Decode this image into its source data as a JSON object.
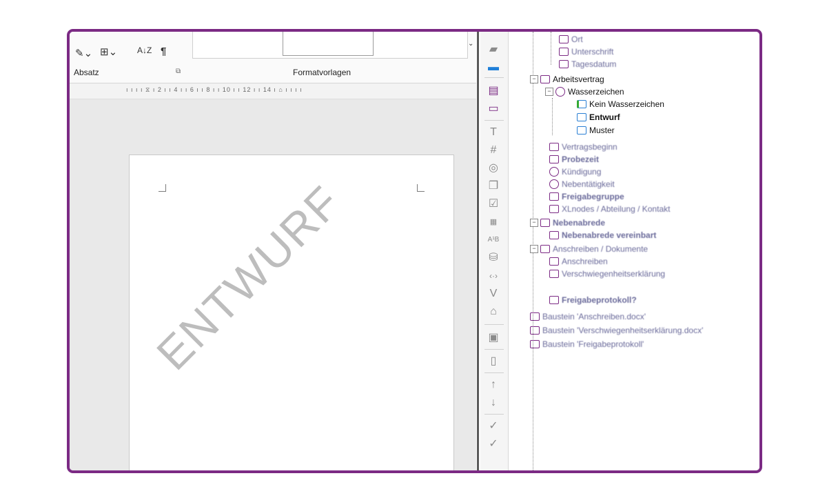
{
  "ribbon": {
    "paragraph_group": "Absatz",
    "styles_group": "Formatvorlagen",
    "sort_label": "A↓Z",
    "pilcrow": "¶"
  },
  "ruler": {
    "scale": "ı ı ı ı ⧖ ı 2 ı  ı 4 ı  ı 6 ı  ı 8 ı  ı 10 ı  ı 12 ı  ı 14 ı  ⌂ ı ı ı ı"
  },
  "document": {
    "watermark": "ENTWURF"
  },
  "tree": {
    "top_items": [
      "Ort",
      "Unterschrift",
      "Tagesdatum"
    ],
    "arbeitsvertrag": "Arbeitsvertrag",
    "wasserzeichen": "Wasserzeichen",
    "kein_wasserzeichen": "Kein Wasserzeichen",
    "entwurf": "Entwurf",
    "muster": "Muster",
    "blurred_items": [
      "Vertragsbeginn",
      "Probezeit",
      "Kündigung",
      "Nebentätigkeit",
      "Freigabegruppe",
      "XLnodes / Abteilung / Kontakt",
      "Nebenabrede",
      "Nebenabrede vereinbart",
      "Anschreiben / Dokumente",
      "Anschreiben",
      "Verschwiegenheitserklärung",
      "Freigabeprotokoll?",
      "Baustein 'Anschreiben.docx'",
      "Baustein 'Verschwiegenheitserklärung.docx'",
      "Baustein 'Freigabeprotokoll'"
    ]
  },
  "icons": {
    "toolbar": [
      "edit-icon",
      "folder-icon",
      "section-icon",
      "monitor-icon",
      "text-icon",
      "number-icon",
      "circle-icon",
      "copy-icon",
      "checkbox-icon",
      "calendar-icon",
      "ab-icon",
      "database-icon",
      "code-icon",
      "v-icon",
      "tag-icon",
      "help-icon",
      "box-icon",
      "arrow-up-icon",
      "arrow-down-icon",
      "check-icon",
      "check-icon"
    ]
  }
}
